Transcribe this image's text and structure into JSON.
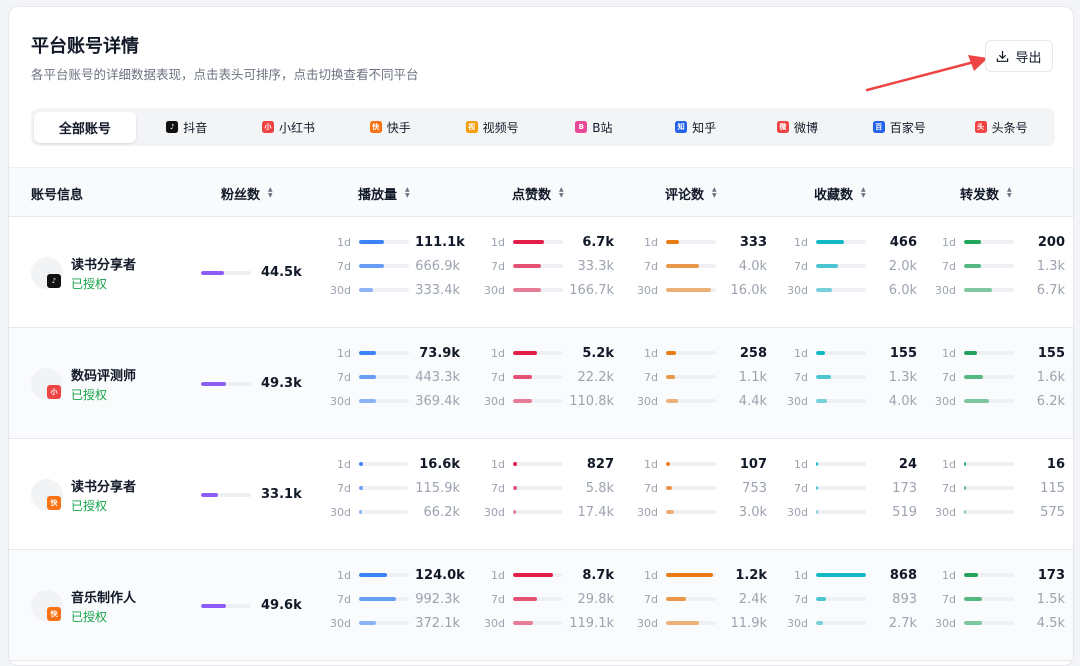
{
  "header": {
    "title": "平台账号详情",
    "subtitle": "各平台账号的详细数据表现，点击表头可排序，点击切换查看不同平台",
    "export_label": "导出"
  },
  "tabs": [
    {
      "label": "全部账号",
      "active": true,
      "icon": "",
      "color": ""
    },
    {
      "label": "抖音",
      "icon": "douyin-icon",
      "color": "#111111",
      "glyph": "♪"
    },
    {
      "label": "小红书",
      "icon": "xiaohongshu-icon",
      "color": "#ef4444",
      "glyph": "小"
    },
    {
      "label": "快手",
      "icon": "kuaishou-icon",
      "color": "#f97316",
      "glyph": "快"
    },
    {
      "label": "视频号",
      "icon": "shipinhao-icon",
      "color": "#f59e0b",
      "glyph": "视"
    },
    {
      "label": "B站",
      "icon": "bilibili-icon",
      "color": "#ec4899",
      "glyph": "B"
    },
    {
      "label": "知乎",
      "icon": "zhihu-icon",
      "color": "#2563eb",
      "glyph": "知"
    },
    {
      "label": "微博",
      "icon": "weibo-icon",
      "color": "#ef4444",
      "glyph": "微"
    },
    {
      "label": "百家号",
      "icon": "baijiahao-icon",
      "color": "#2563eb",
      "glyph": "百"
    },
    {
      "label": "头条号",
      "icon": "toutiao-icon",
      "color": "#ef4444",
      "glyph": "头"
    }
  ],
  "columns": {
    "account": "账号信息",
    "fans": "粉丝数",
    "plays": "播放量",
    "likes": "点赞数",
    "comments": "评论数",
    "favorites": "收藏数",
    "shares": "转发数"
  },
  "period_labels": [
    "1d",
    "7d",
    "30d"
  ],
  "colors": {
    "fans": "#8b5cf6",
    "plays": "#3b82f6",
    "likes": "#e11d48",
    "comments": "#ea7a12",
    "favorites": "#14b8c4",
    "shares": "#22a55b",
    "authorized": "#16a34a"
  },
  "rows": [
    {
      "name": "读书分享者",
      "status": "已授权",
      "platform_icon": "douyin-icon",
      "platform_color": "#111111",
      "platform_glyph": "♪",
      "fans": {
        "value": "44.5k",
        "level": 0.45
      },
      "plays": [
        {
          "value": "111.1k",
          "level": 0.5
        },
        {
          "value": "666.9k",
          "level": 0.5
        },
        {
          "value": "333.4k",
          "level": 0.28
        }
      ],
      "likes": [
        {
          "value": "6.7k",
          "level": 0.62
        },
        {
          "value": "33.3k",
          "level": 0.55
        },
        {
          "value": "166.7k",
          "level": 0.55
        }
      ],
      "comments": [
        {
          "value": "333",
          "level": 0.25
        },
        {
          "value": "4.0k",
          "level": 0.66
        },
        {
          "value": "16.0k",
          "level": 0.9
        }
      ],
      "favorites": [
        {
          "value": "466",
          "level": 0.55
        },
        {
          "value": "2.0k",
          "level": 0.44
        },
        {
          "value": "6.0k",
          "level": 0.32
        }
      ],
      "shares": [
        {
          "value": "200",
          "level": 0.33
        },
        {
          "value": "1.3k",
          "level": 0.33
        },
        {
          "value": "6.7k",
          "level": 0.55
        }
      ]
    },
    {
      "name": "数码评测师",
      "status": "已授权",
      "platform_icon": "xiaohongshu-icon",
      "platform_color": "#ef4444",
      "platform_glyph": "小",
      "fans": {
        "value": "49.3k",
        "level": 0.5
      },
      "plays": [
        {
          "value": "73.9k",
          "level": 0.33
        },
        {
          "value": "443.3k",
          "level": 0.33
        },
        {
          "value": "369.4k",
          "level": 0.33
        }
      ],
      "likes": [
        {
          "value": "5.2k",
          "level": 0.48
        },
        {
          "value": "22.2k",
          "level": 0.37
        },
        {
          "value": "110.8k",
          "level": 0.37
        }
      ],
      "comments": [
        {
          "value": "258",
          "level": 0.2
        },
        {
          "value": "1.1k",
          "level": 0.18
        },
        {
          "value": "4.4k",
          "level": 0.24
        }
      ],
      "favorites": [
        {
          "value": "155",
          "level": 0.18
        },
        {
          "value": "1.3k",
          "level": 0.3
        },
        {
          "value": "4.0k",
          "level": 0.22
        }
      ],
      "shares": [
        {
          "value": "155",
          "level": 0.26
        },
        {
          "value": "1.6k",
          "level": 0.38
        },
        {
          "value": "6.2k",
          "level": 0.5
        }
      ]
    },
    {
      "name": "读书分享者",
      "status": "已授权",
      "platform_icon": "kuaishou-icon",
      "platform_color": "#f97316",
      "platform_glyph": "快",
      "fans": {
        "value": "33.1k",
        "level": 0.33
      },
      "plays": [
        {
          "value": "16.6k",
          "level": 0.07
        },
        {
          "value": "115.9k",
          "level": 0.07
        },
        {
          "value": "66.2k",
          "level": 0.05
        }
      ],
      "likes": [
        {
          "value": "827",
          "level": 0.07
        },
        {
          "value": "5.8k",
          "level": 0.07
        },
        {
          "value": "17.4k",
          "level": 0.05
        }
      ],
      "comments": [
        {
          "value": "107",
          "level": 0.08
        },
        {
          "value": "753",
          "level": 0.12
        },
        {
          "value": "3.0k",
          "level": 0.16
        }
      ],
      "favorites": [
        {
          "value": "24",
          "level": 0.02
        },
        {
          "value": "173",
          "level": 0.02
        },
        {
          "value": "519",
          "level": 0.02
        }
      ],
      "shares": [
        {
          "value": "16",
          "level": 0.02
        },
        {
          "value": "115",
          "level": 0.02
        },
        {
          "value": "575",
          "level": 0.02
        }
      ]
    },
    {
      "name": "音乐制作人",
      "status": "已授权",
      "platform_icon": "kuaishou-icon",
      "platform_color": "#f97316",
      "platform_glyph": "快",
      "fans": {
        "value": "49.6k",
        "level": 0.5
      },
      "plays": [
        {
          "value": "124.0k",
          "level": 0.55
        },
        {
          "value": "992.3k",
          "level": 0.74
        },
        {
          "value": "372.1k",
          "level": 0.33
        }
      ],
      "likes": [
        {
          "value": "8.7k",
          "level": 0.8
        },
        {
          "value": "29.8k",
          "level": 0.48
        },
        {
          "value": "119.1k",
          "level": 0.4
        }
      ],
      "comments": [
        {
          "value": "1.2k",
          "level": 0.94
        },
        {
          "value": "2.4k",
          "level": 0.4
        },
        {
          "value": "11.9k",
          "level": 0.66
        }
      ],
      "favorites": [
        {
          "value": "868",
          "level": 1.0
        },
        {
          "value": "893",
          "level": 0.2
        },
        {
          "value": "2.7k",
          "level": 0.14
        }
      ],
      "shares": [
        {
          "value": "173",
          "level": 0.28
        },
        {
          "value": "1.5k",
          "level": 0.36
        },
        {
          "value": "4.5k",
          "level": 0.36
        }
      ]
    }
  ]
}
